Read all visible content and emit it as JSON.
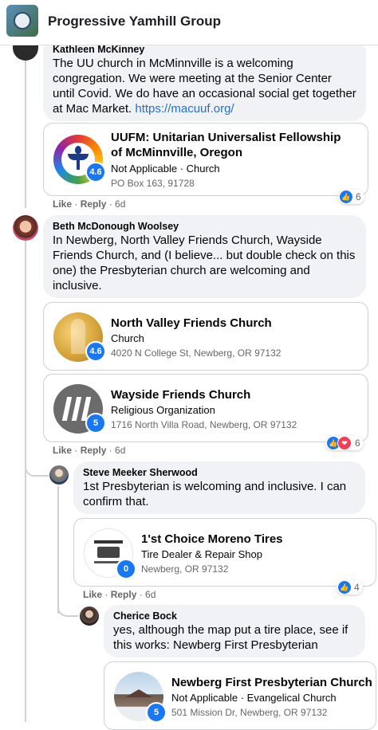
{
  "header": {
    "title": "Progressive Yamhill Group"
  },
  "comments": [
    {
      "author": "Kathleen McKinney",
      "text": "The UU church in McMinnville is a welcoming congregation. We were meeting at the Senior Center until Covid. We do have an occasional social get together at Mac Market. ",
      "link": "https://macuuf.org/",
      "cards": [
        {
          "title": "UUFM: Unitarian Universalist Fellowship of McMinnville, Oregon",
          "category": "Not Applicable · Church",
          "address": "PO Box 163, 91728",
          "rating": "4.6"
        }
      ],
      "like": "Like",
      "reply": "Reply",
      "time": "6d",
      "reaction_count": "6"
    },
    {
      "author": "Beth McDonough Woolsey",
      "text": "In Newberg, North Valley Friends Church, Wayside Friends Church, and (I believe... but double check on this one) the Presbyterian church are welcoming and inclusive.",
      "cards": [
        {
          "title": "North Valley Friends Church",
          "category": "Church",
          "address": "4020 N College St, Newberg, OR 97132",
          "rating": "4.6"
        },
        {
          "title": "Wayside Friends Church",
          "category": "Religious Organization",
          "address": "1716 North Villa Road, Newberg, OR 97132",
          "rating": "5"
        }
      ],
      "like": "Like",
      "reply": "Reply",
      "time": "6d",
      "reaction_count": "6"
    },
    {
      "author": "Steve Meeker Sherwood",
      "text": "1st Presbyterian is welcoming and inclusive. I can confirm that.",
      "cards": [
        {
          "title": "1'st Choice Moreno Tires",
          "category": "Tire Dealer & Repair Shop",
          "address": "Newberg, OR 97132",
          "rating": "0"
        }
      ],
      "like": "Like",
      "reply": "Reply",
      "time": "6d",
      "reaction_count": "4"
    },
    {
      "author": "Cherice Bock",
      "text": "yes, although the map put a tire place, see if this works: Newberg First Presbyterian",
      "cards": [
        {
          "title": "Newberg First Presbyterian Church",
          "category": "Not Applicable · Evangelical Church",
          "address": "501 Mission Dr, Newberg, OR 97132",
          "rating": "5"
        }
      ]
    }
  ],
  "colors": {
    "accent": "#1877f2",
    "bubble": "#f0f2f5",
    "link": "#216fdb",
    "love": "#f33e58"
  }
}
